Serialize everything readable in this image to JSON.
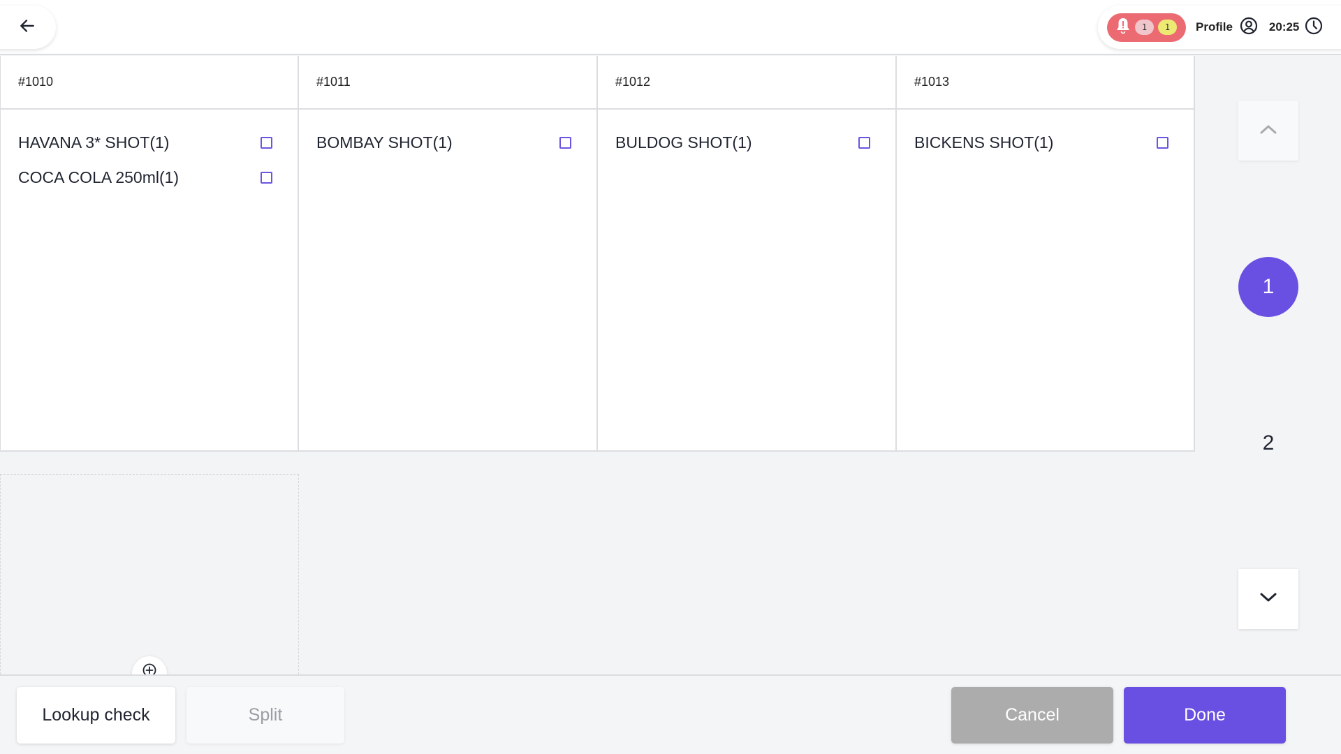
{
  "header": {
    "back_icon": "arrow-left-icon",
    "notifications": {
      "icon": "bell-alert-icon",
      "count_pink": "1",
      "count_yellow": "1",
      "accent_color": "#ec6b73"
    },
    "profile_label": "Profile",
    "profile_icon": "user-circle-icon",
    "time": "20:25",
    "clock_icon": "clock-icon"
  },
  "checks": [
    {
      "id": "#1010",
      "items": [
        {
          "label": "HAVANA 3* SHOT(1)",
          "checked": false
        },
        {
          "label": "COCA COLA 250ml(1)",
          "checked": false
        }
      ]
    },
    {
      "id": "#1011",
      "items": [
        {
          "label": "BOMBAY SHOT(1)",
          "checked": false
        }
      ]
    },
    {
      "id": "#1012",
      "items": [
        {
          "label": "BULDOG SHOT(1)",
          "checked": false
        }
      ]
    },
    {
      "id": "#1013",
      "items": [
        {
          "label": "BICKENS SHOT(1)",
          "checked": false
        }
      ]
    }
  ],
  "add_check_icon": "plus-circle-icon",
  "pagination": {
    "up_icon": "chevron-up-icon",
    "down_icon": "chevron-down-icon",
    "pages": [
      "1",
      "2"
    ],
    "current_page": "1",
    "accent_color": "#6a4fe3"
  },
  "footer": {
    "lookup_label": "Lookup check",
    "split_label": "Split",
    "cancel_label": "Cancel",
    "done_label": "Done"
  }
}
